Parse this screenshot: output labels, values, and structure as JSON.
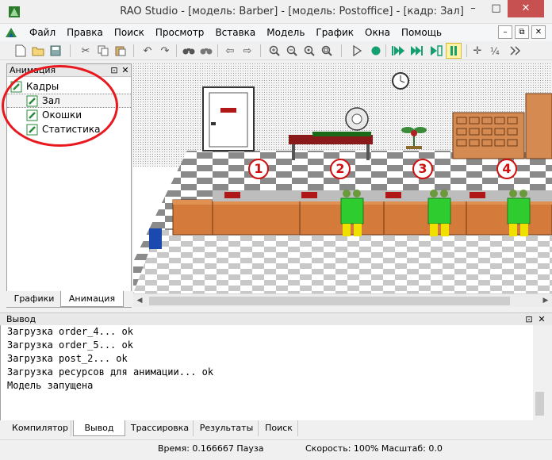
{
  "window": {
    "title": "RAO Studio - [модель: Barber] - [модель: Postoffice] - [кадр: Зал]",
    "min_glyph": "–",
    "max_glyph": "□",
    "close_glyph": "✕"
  },
  "menu": {
    "items": [
      "Файл",
      "Правка",
      "Поиск",
      "Просмотр",
      "Вставка",
      "Модель",
      "График",
      "Окна",
      "Помощь"
    ]
  },
  "mdi_buttons": [
    "–",
    "⧉",
    "✕"
  ],
  "toolbar": {
    "icons": [
      "new-file-icon",
      "open-icon",
      "save-icon",
      "cut-icon",
      "copy-icon",
      "paste-icon",
      "undo-icon",
      "redo-icon",
      "find-icon",
      "find-next-icon",
      "back-icon",
      "forward-icon",
      "zoom-in-icon",
      "zoom-out-icon",
      "zoom-reset-icon",
      "zoom-fit-icon",
      "run-icon",
      "stop-icon",
      "fast-forward-icon",
      "step-icon",
      "play-frame-icon",
      "pause-icon",
      "plus-icon",
      "sync-icon",
      "skip-icon"
    ]
  },
  "left_panel": {
    "title": "Анимация",
    "pin_glyph": "⊡",
    "close_glyph": "✕",
    "tree_root": "Кадры",
    "tree_items": [
      "Зал",
      "Окошки",
      "Статистика"
    ],
    "tabs": [
      "Графики",
      "Анимация"
    ],
    "active_tab": "Анимация"
  },
  "scene": {
    "windows": [
      "1",
      "2",
      "3",
      "4"
    ],
    "colors": {
      "counter": "#d47a3a",
      "customer_shirt": "#2ecc2e",
      "customer_pants": "#f0e000",
      "window_circle_border": "#d01010"
    }
  },
  "output": {
    "title": "Вывод",
    "pin_glyph": "⊡",
    "close_glyph": "✕",
    "lines": [
      "Загрузка order_4... ok",
      "Загрузка order_5... ok",
      "Загрузка post_2... ok",
      "Загрузка ресурсов для анимации... ok",
      "Модель запущена"
    ],
    "tabs": [
      "Компилятор",
      "Вывод",
      "Трассировка",
      "Результаты",
      "Поиск"
    ],
    "active_tab": "Вывод"
  },
  "status": {
    "time": "Время: 0.166667 Пауза",
    "speed": "Скорость: 100% Масштаб: 0.0"
  }
}
